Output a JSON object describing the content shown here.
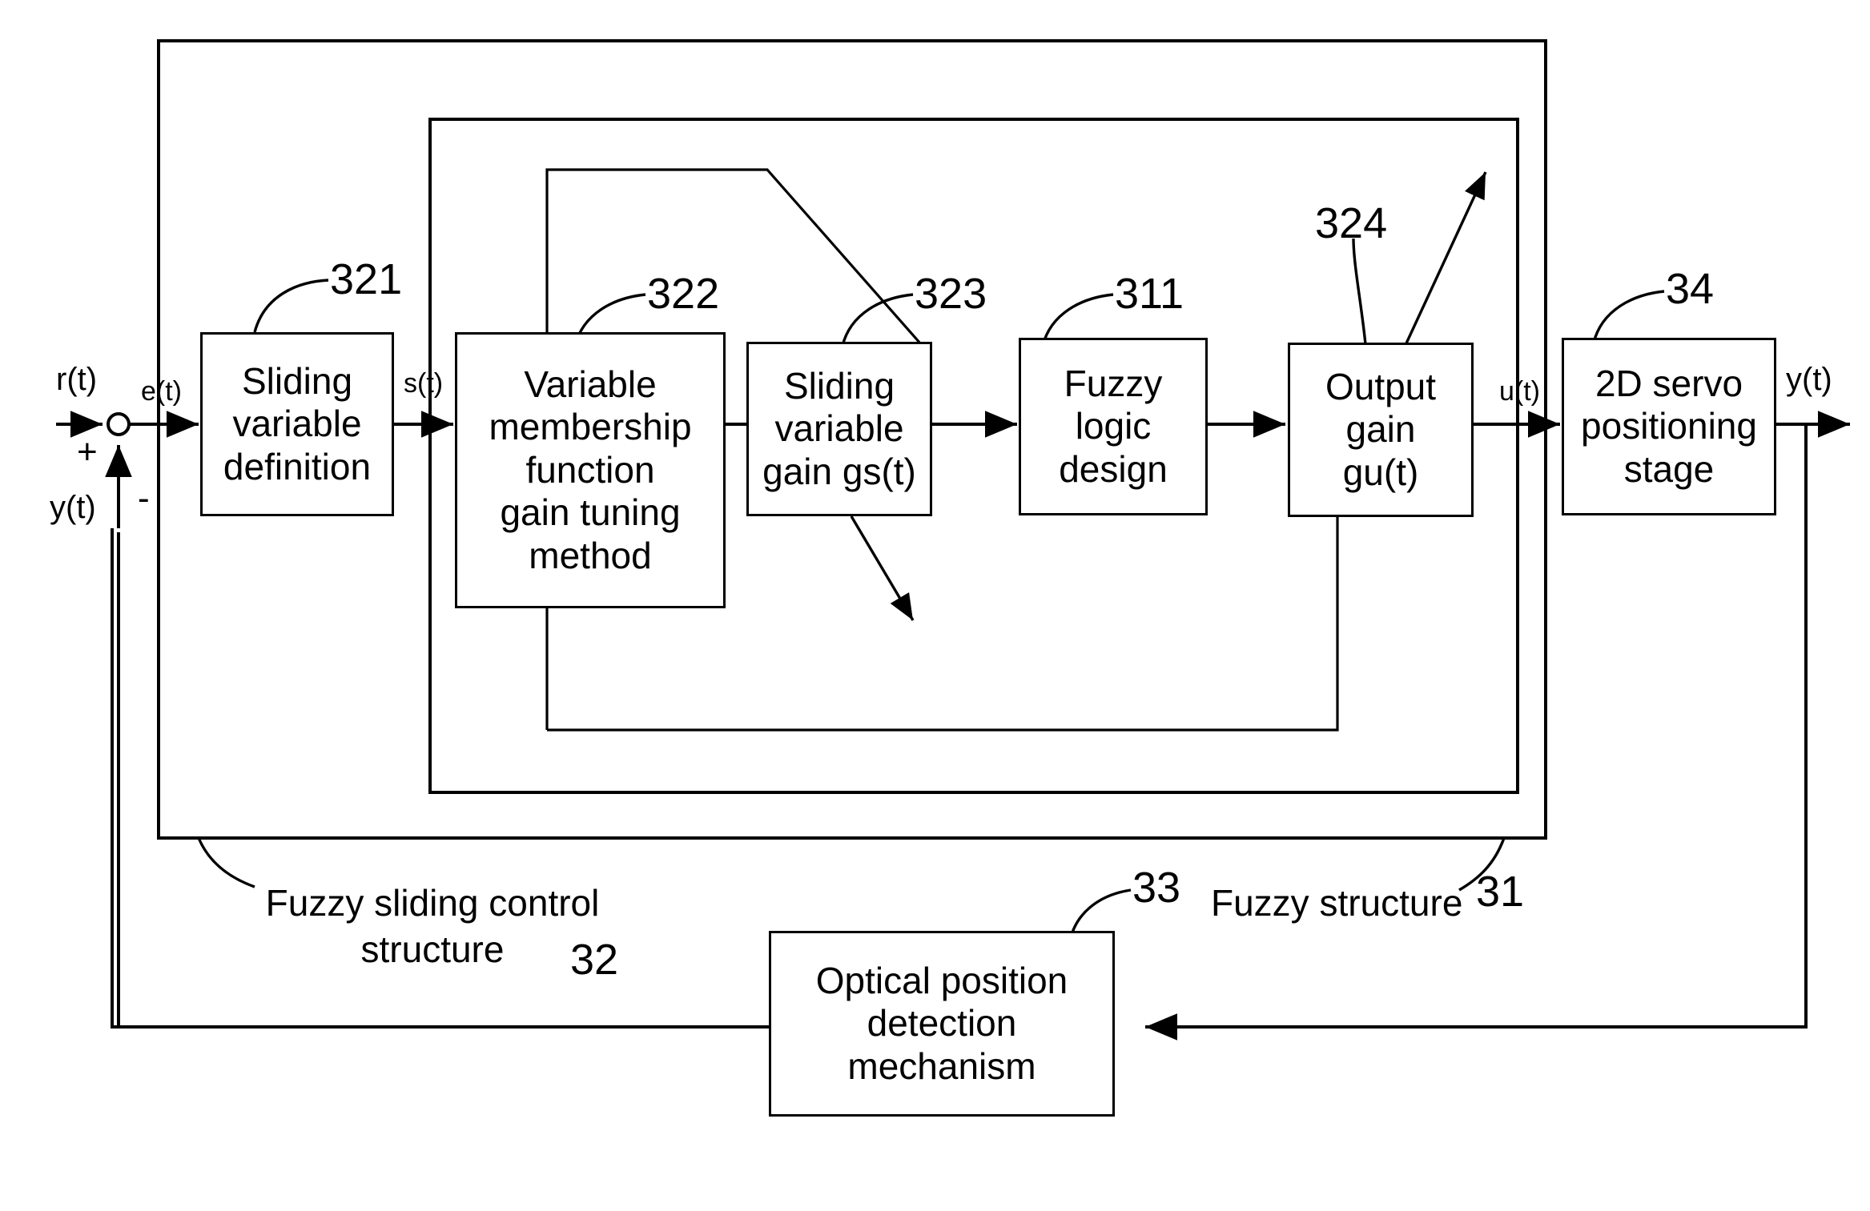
{
  "diagram": {
    "title": "Fuzzy sliding mode control block diagram",
    "blocks": [
      {
        "id": "sliding-variable-definition",
        "label": "Sliding\nvariable\ndefinition",
        "ref": "321"
      },
      {
        "id": "variable-membership-function-gain-tuning-method",
        "label": "Variable\nmembership\nfunction\ngain tuning\nmethod",
        "ref": "322"
      },
      {
        "id": "sliding-variable-gain",
        "label": "Sliding\nvariable\ngain gs(t)",
        "ref": "323"
      },
      {
        "id": "fuzzy-logic-design",
        "label": "Fuzzy\nlogic\ndesign",
        "ref": "311"
      },
      {
        "id": "output-gain",
        "label": "Output\ngain\ngu(t)",
        "ref": "324"
      },
      {
        "id": "2d-servo-positioning-stage",
        "label": "2D servo\npositioning\nstage",
        "ref": "34"
      },
      {
        "id": "optical-position-detection-mechanism",
        "label": "Optical position\ndetection\nmechanism",
        "ref": "33"
      }
    ],
    "refnums": {
      "r321": "321",
      "r322": "322",
      "r323": "323",
      "r311": "311",
      "r324": "324",
      "r34": "34",
      "r33": "33",
      "r32": "32",
      "r31": "31"
    },
    "signals": {
      "reference": "r(t)",
      "error": "e(t)",
      "sliding": "s(t)",
      "control": "u(t)",
      "output": "y(t)",
      "feedback": "y(t)",
      "plus": "+",
      "minus": "-"
    },
    "captions": {
      "fuzzy_sliding_control_structure": "Fuzzy sliding\ncontrol structure",
      "fuzzy_structure": "Fuzzy structure"
    },
    "colors": {
      "line": "#000000",
      "background": "#ffffff"
    }
  }
}
